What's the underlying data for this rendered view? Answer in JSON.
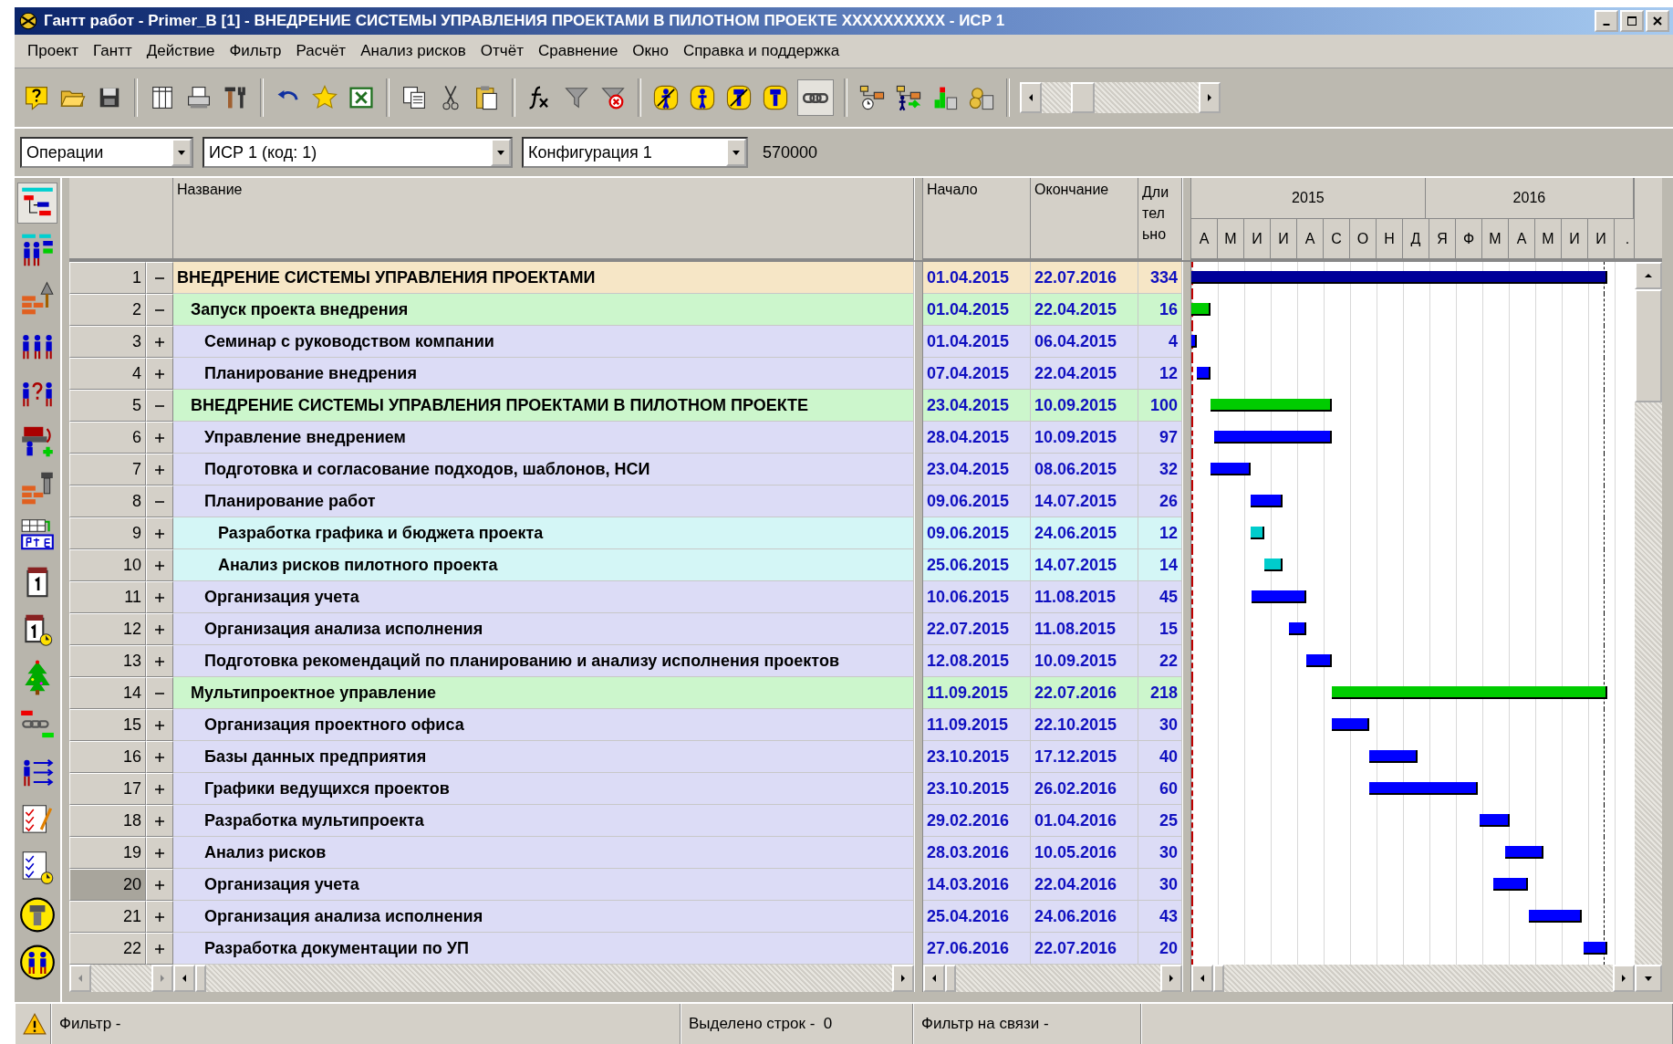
{
  "window": {
    "title": "Гантт работ - Primer_B [1] - ВНЕДРЕНИЕ СИСТЕМЫ УПРАВЛЕНИЯ ПРОЕКТАМИ В ПИЛОТНОМ ПРОЕКТЕ XXXXXXXXXX - ИСР 1"
  },
  "menu": [
    "Проект",
    "Гантт",
    "Действие",
    "Фильтр",
    "Расчёт",
    "Анализ рисков",
    "Отчёт",
    "Сравнение",
    "Окно",
    "Справка и поддержка"
  ],
  "selectors": {
    "view": "Операции",
    "wbs": "ИСР 1 (код: 1)",
    "configuration": "Конфигурация 1",
    "number": "570000"
  },
  "table": {
    "columns": {
      "name": "Название",
      "start": "Начало",
      "end": "Окончание",
      "duration": "Длительно"
    },
    "timeline": [
      {
        "label": "2015",
        "months": [
          "А",
          "М",
          "И",
          "И",
          "А",
          "С",
          "О",
          "Н",
          "Д"
        ]
      },
      {
        "label": "2016",
        "months": [
          "Я",
          "Ф",
          "М",
          "А",
          "М",
          "И",
          "И",
          "."
        ]
      }
    ],
    "tasks": [
      {
        "num": "1",
        "expanded": true,
        "selected": false,
        "name": "ВНЕДРЕНИЕ СИСТЕМЫ УПРАВЛЕНИЯ ПРОЕКТАМИ",
        "start": "01.04.2015",
        "end": "22.07.2016",
        "duration": "334",
        "children": [
          {
            "num": "2",
            "expanded": true,
            "selected": false,
            "name": "Запуск проекта внедрения",
            "start": "01.04.2015",
            "end": "22.04.2015",
            "duration": "16",
            "children": [
              {
                "num": "3",
                "expanded": false,
                "selected": false,
                "name": "Семинар с руководством компании",
                "start": "01.04.2015",
                "end": "06.04.2015",
                "duration": "4"
              },
              {
                "num": "4",
                "expanded": false,
                "selected": false,
                "name": "Планирование внедрения",
                "start": "07.04.2015",
                "end": "22.04.2015",
                "duration": "12"
              }
            ]
          },
          {
            "num": "5",
            "expanded": true,
            "selected": false,
            "name": "ВНЕДРЕНИЕ СИСТЕМЫ УПРАВЛЕНИЯ ПРОЕКТАМИ В ПИЛОТНОМ ПРОЕКТЕ",
            "start": "23.04.2015",
            "end": "10.09.2015",
            "duration": "100",
            "children": [
              {
                "num": "6",
                "expanded": false,
                "selected": false,
                "name": "Управление внедрением",
                "start": "28.04.2015",
                "end": "10.09.2015",
                "duration": "97"
              },
              {
                "num": "7",
                "expanded": false,
                "selected": false,
                "name": "Подготовка и согласование подходов, шаблонов, НСИ",
                "start": "23.04.2015",
                "end": "08.06.2015",
                "duration": "32"
              },
              {
                "num": "8",
                "expanded": true,
                "selected": false,
                "name": "Планирование работ",
                "start": "09.06.2015",
                "end": "14.07.2015",
                "duration": "26",
                "children": [
                  {
                    "num": "9",
                    "expanded": false,
                    "selected": false,
                    "name": "Разработка графика и бюджета проекта",
                    "start": "09.06.2015",
                    "end": "24.06.2015",
                    "duration": "12"
                  },
                  {
                    "num": "10",
                    "expanded": false,
                    "selected": false,
                    "name": "Анализ рисков пилотного проекта",
                    "start": "25.06.2015",
                    "end": "14.07.2015",
                    "duration": "14"
                  }
                ]
              },
              {
                "num": "11",
                "expanded": false,
                "selected": false,
                "name": "Организация учета",
                "start": "10.06.2015",
                "end": "11.08.2015",
                "duration": "45"
              },
              {
                "num": "12",
                "expanded": false,
                "selected": false,
                "name": "Организация анализа исполнения",
                "start": "22.07.2015",
                "end": "11.08.2015",
                "duration": "15"
              },
              {
                "num": "13",
                "expanded": false,
                "selected": false,
                "name": "Подготовка рекомендаций по планированию и анализу исполнения проектов",
                "start": "12.08.2015",
                "end": "10.09.2015",
                "duration": "22"
              }
            ]
          },
          {
            "num": "14",
            "expanded": true,
            "selected": false,
            "name": "Мультипроектное управление",
            "start": "11.09.2015",
            "end": "22.07.2016",
            "duration": "218",
            "children": [
              {
                "num": "15",
                "expanded": false,
                "selected": false,
                "name": "Организация проектного офиса",
                "start": "11.09.2015",
                "end": "22.10.2015",
                "duration": "30"
              },
              {
                "num": "16",
                "expanded": false,
                "selected": false,
                "name": "Базы данных предприятия",
                "start": "23.10.2015",
                "end": "17.12.2015",
                "duration": "40"
              },
              {
                "num": "17",
                "expanded": false,
                "selected": false,
                "name": "Графики ведущихся проектов",
                "start": "23.10.2015",
                "end": "26.02.2016",
                "duration": "60"
              },
              {
                "num": "18",
                "expanded": false,
                "selected": false,
                "name": "Разработка мультипроекта",
                "start": "29.02.2016",
                "end": "01.04.2016",
                "duration": "25"
              },
              {
                "num": "19",
                "expanded": false,
                "selected": false,
                "name": "Анализ рисков",
                "start": "28.03.2016",
                "end": "10.05.2016",
                "duration": "30"
              },
              {
                "num": "20",
                "expanded": false,
                "selected": true,
                "name": "Организация учета",
                "start": "14.03.2016",
                "end": "22.04.2016",
                "duration": "30"
              },
              {
                "num": "21",
                "expanded": false,
                "selected": false,
                "name": "Организация анализа исполнения",
                "start": "25.04.2016",
                "end": "24.06.2016",
                "duration": "43"
              },
              {
                "num": "22",
                "expanded": false,
                "selected": false,
                "name": "Разработка документации по УП",
                "start": "27.06.2016",
                "end": "22.07.2016",
                "duration": "20"
              }
            ]
          }
        ]
      }
    ]
  },
  "status_bar": {
    "filter": "Фильтр -",
    "selected_rows": "Выделено строк -  0",
    "link_filter": "Фильтр на связи -"
  }
}
